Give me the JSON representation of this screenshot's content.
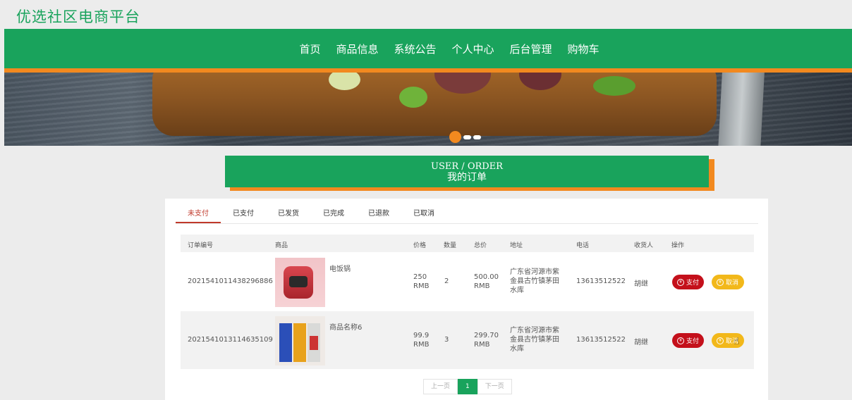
{
  "site": {
    "title": "优选社区电商平台"
  },
  "nav": {
    "items": [
      "首页",
      "商品信息",
      "系统公告",
      "个人中心",
      "后台管理",
      "购物车"
    ]
  },
  "section": {
    "title_en": "USER / ORDER",
    "title_cn": "我的订单"
  },
  "tabs": [
    {
      "label": "未支付",
      "active": true
    },
    {
      "label": "已支付",
      "active": false
    },
    {
      "label": "已发货",
      "active": false
    },
    {
      "label": "已完成",
      "active": false
    },
    {
      "label": "已退款",
      "active": false
    },
    {
      "label": "已取消",
      "active": false
    }
  ],
  "table": {
    "headers": {
      "order_no": "订单编号",
      "product": "商品",
      "price": "价格",
      "qty": "数量",
      "total": "总价",
      "address": "地址",
      "phone": "电话",
      "receiver": "收货人",
      "actions": "操作"
    },
    "rows": [
      {
        "order_no": "2021541011438296886",
        "product_name": "电饭锅",
        "price": "250",
        "price_unit": "RMB",
        "qty": "2",
        "total": "500.00",
        "total_unit": "RMB",
        "address_l1": "广东省河源市紫",
        "address_l2": "金县古竹镇茅田",
        "address_l3": "水库",
        "phone": "13613512522",
        "receiver": "胡继",
        "pay_label": "支付",
        "cancel_label": "取消"
      },
      {
        "order_no": "2021541013114635109",
        "product_name": "商品名称6",
        "price": "99.9",
        "price_unit": "RMB",
        "qty": "3",
        "total": "299.70",
        "total_unit": "RMB",
        "address_l1": "广东省河源市紫",
        "address_l2": "金县古竹镇茅田",
        "address_l3": "水库",
        "phone": "13613512522",
        "receiver": "胡继",
        "pay_label": "支付",
        "cancel_label": "取消"
      }
    ]
  },
  "pager": {
    "prev": "上一页",
    "current": "1",
    "next": "下一页"
  },
  "colors": {
    "brand_green": "#19a35c",
    "accent_orange": "#f2891f",
    "pay_red": "#c4101b",
    "cancel_yellow": "#f2b81a"
  }
}
